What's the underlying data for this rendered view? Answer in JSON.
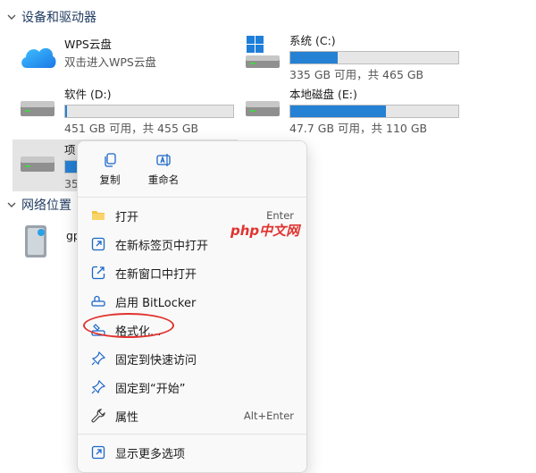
{
  "sections": {
    "devices_title": "设备和驱动器",
    "network_title": "网络位置"
  },
  "drives": [
    {
      "name": "WPS云盘",
      "sub": "双击进入WPS云盘",
      "icon": "cloud-icon"
    },
    {
      "name": "系统 (C:)",
      "sub": "335 GB 可用，共 465 GB",
      "used_fraction": 0.28,
      "icon": "windows-drive-icon"
    },
    {
      "name": "软件 (D:)",
      "sub": "451 GB 可用，共 455 GB",
      "used_fraction": 0.01,
      "icon": "drive-icon"
    },
    {
      "name": "本地磁盘 (E:)",
      "sub": "47.7 GB 可用，共 110 GB",
      "used_fraction": 0.57,
      "icon": "drive-icon"
    },
    {
      "name": "项",
      "sub": "35",
      "used_fraction": 0.9,
      "icon": "drive-icon"
    }
  ],
  "network": [
    {
      "name": "gp",
      "icon": "network-drive-icon"
    }
  ],
  "context_menu": {
    "quick_actions": [
      {
        "label": "复制",
        "icon": "copy-icon"
      },
      {
        "label": "重命名",
        "icon": "rename-icon"
      }
    ],
    "items": [
      {
        "label": "打开",
        "shortcut": "Enter",
        "icon": "folder-icon"
      },
      {
        "label": "在新标签页中打开",
        "shortcut": "",
        "icon": "open-tab-icon"
      },
      {
        "label": "在新窗口中打开",
        "shortcut": "",
        "icon": "open-window-icon"
      },
      {
        "label": "启用 BitLocker",
        "shortcut": "",
        "icon": "bitlocker-icon"
      },
      {
        "label": "格式化...",
        "shortcut": "",
        "icon": "format-icon"
      },
      {
        "label": "固定到快速访问",
        "shortcut": "",
        "icon": "pin-icon"
      },
      {
        "label": "固定到“开始”",
        "shortcut": "",
        "icon": "pin-icon"
      },
      {
        "label": "属性",
        "shortcut": "Alt+Enter",
        "icon": "wrench-icon"
      }
    ],
    "more_label": "显示更多选项"
  },
  "watermark": "php中文网",
  "colors": {
    "accent": "#2581d3",
    "highlight": "#e0332f"
  }
}
